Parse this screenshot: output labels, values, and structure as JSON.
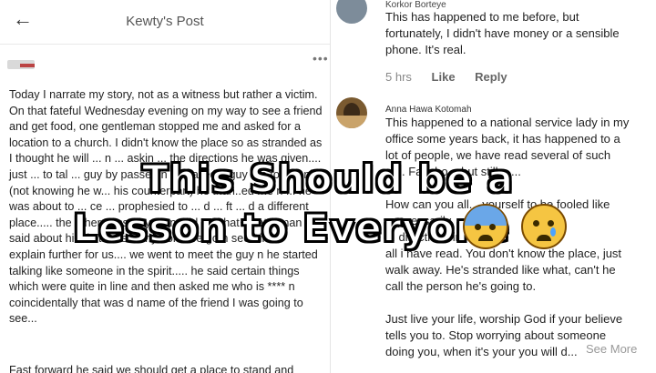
{
  "header": {
    "title": "Kewty's Post",
    "back_icon": "back-arrow-icon"
  },
  "post": {
    "text": "Today I narrate my story, not as a witness but rather a victim.\nOn that fateful Wednesday evening on my way to see a friend and get food, one gentleman stopped me and asked for a location to a church. I didn't know the place so as stranded as I thought he will ... n ... askin ... the directions he was given.... just ... to tal ... guy by passed n he called d guy too to ask nim (not knowing he w... his counterpart) he than..ed me n ... he was about to ... ce ... prophesied to ... d ... ft ... d a different place..... the other passerby then told me that what d man said about him is true so why don't we go n see him to explain further for us.... we went to meet the guy n he started talking like someone in the spirit..... he said certain things which were quite in line and then asked me who is **** n coincidentally that was d name of the friend I was going to see...",
    "cut_line": "Fast forward he said we should get a place to stand and"
  },
  "comments": [
    {
      "name": "Korkor Borteye",
      "text": "This has happened to me before, but\nfortunately, I didn't have money or a sensible\nphone. It's real.",
      "time": "5 hrs",
      "like_label": "Like",
      "reply_label": "Reply"
    },
    {
      "name": "Anna Hawa Kotomah",
      "text": "This happened to a national service lady in my\noffice some years back, it has happened to a\nlot of people, we have read several of such\n...... Facebo... but still.......\n\nHow can you all... yourself to be fooled like\n... ecessarily,\n... directions in\nall i have read. You don't know the place, just\nwalk away. He's stranded like what, can't he\ncall the person he's going to.\n\nJust live your life, worship God if your believe\ntells you to. Stop worrying about someone\ndoing you, when it's your you will d...",
      "see_more": "See More"
    }
  ],
  "overlay": {
    "line1": "This Should be a",
    "line2": "Lesson to Everyone"
  }
}
